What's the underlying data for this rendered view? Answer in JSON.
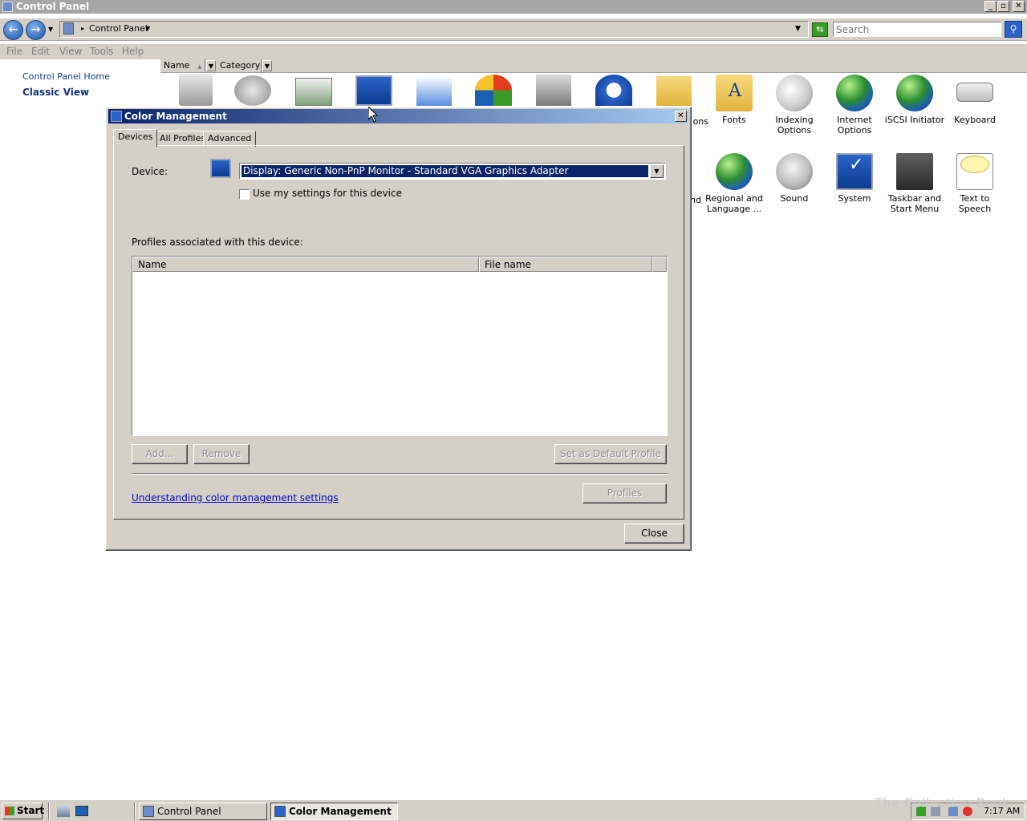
{
  "window": {
    "title": "Control Panel",
    "minimize": "_",
    "maximize": "▫",
    "close": "✕"
  },
  "address": {
    "back": "←",
    "forward": "→",
    "path": "Control Panel",
    "search_placeholder": "Search"
  },
  "menu": [
    "File",
    "Edit",
    "View",
    "Tools",
    "Help"
  ],
  "columns": [
    "Name",
    "Category"
  ],
  "sidebar": {
    "home": "Control Panel Home",
    "classic": "Classic View"
  },
  "icons": {
    "row1": [
      {
        "label": "ons",
        "icon": "folder-checklist-icon"
      },
      {
        "label": "Fonts",
        "icon": "fonts-folder-icon"
      },
      {
        "label": "Indexing Options",
        "icon": "indexing-options-icon"
      },
      {
        "label": "Internet Options",
        "icon": "internet-options-icon"
      },
      {
        "label": "iSCSI Initiator",
        "icon": "iscsi-initiator-icon"
      },
      {
        "label": "Keyboard",
        "icon": "keyboard-icon"
      }
    ],
    "row2": [
      {
        "label": "nd",
        "icon": "partial-icon"
      },
      {
        "label": "Regional and Language ...",
        "icon": "regional-language-icon"
      },
      {
        "label": "Sound",
        "icon": "sound-icon"
      },
      {
        "label": "System",
        "icon": "system-icon"
      },
      {
        "label": "Taskbar and Start Menu",
        "icon": "taskbar-start-menu-icon"
      },
      {
        "label": "Text to Speech",
        "icon": "text-to-speech-icon"
      }
    ]
  },
  "dialog": {
    "title": "Color Management",
    "close": "✕",
    "tabs": [
      "Devices",
      "All Profiles",
      "Advanced"
    ],
    "device_label": "Device:",
    "device_value": "Display: Generic Non-PnP Monitor - Standard VGA Graphics Adapter",
    "use_settings_label": "Use my settings for this device",
    "use_settings_checked": false,
    "profiles_label": "Profiles associated with this device:",
    "list_columns": [
      "Name",
      "File name"
    ],
    "add": "Add...",
    "remove": "Remove",
    "set_default": "Set as Default Profile",
    "understanding_link": "Understanding color management settings",
    "profiles_button": "Profiles",
    "close_button": "Close"
  },
  "taskbar": {
    "start": "Start",
    "items": [
      "Control Panel",
      "Color Management"
    ],
    "clock": "7:17 AM"
  },
  "watermark": "The Collection Book"
}
